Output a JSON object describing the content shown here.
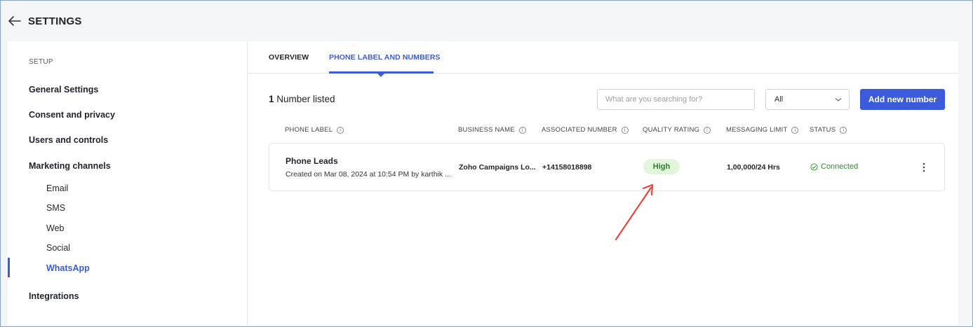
{
  "header": {
    "title": "SETTINGS"
  },
  "sidebar": {
    "section_label": "SETUP",
    "items": [
      {
        "label": "General Settings"
      },
      {
        "label": "Consent and privacy"
      },
      {
        "label": "Users and controls"
      },
      {
        "label": "Marketing channels"
      }
    ],
    "sub_items": [
      {
        "label": "Email"
      },
      {
        "label": "SMS"
      },
      {
        "label": "Web"
      },
      {
        "label": "Social"
      },
      {
        "label": "WhatsApp"
      }
    ],
    "integrations_label": "Integrations",
    "active_item": "WhatsApp"
  },
  "tabs": [
    {
      "label": "OVERVIEW"
    },
    {
      "label": "PHONE LABEL AND NUMBERS"
    }
  ],
  "active_tab": "PHONE LABEL AND NUMBERS",
  "toolbar": {
    "count": "1",
    "count_suffix": " Number listed",
    "search_placeholder": "What are you searching for?",
    "filter_value": "All",
    "add_button": "Add new number"
  },
  "table": {
    "columns": [
      "PHONE LABEL",
      "BUSINESS NAME",
      "ASSOCIATED NUMBER",
      "QUALITY RATING",
      "MESSAGING LIMIT",
      "STATUS"
    ],
    "rows": [
      {
        "label": "Phone Leads",
        "created": "Created on Mar 08, 2024 at 10:54 PM by karthik ...",
        "business_name": "Zoho Campaigns Lo...",
        "number": "+14158018898",
        "quality": "High",
        "limit": "1,00,000/24 Hrs",
        "status": "Connected"
      }
    ]
  },
  "colors": {
    "accent": "#3b5bdb",
    "badge_bg": "#e1f6db",
    "status_green": "#2e8b2e",
    "annotation_arrow": "#e8453c"
  },
  "icons": {
    "back": "arrow-left-icon",
    "info": "info-icon",
    "chevron": "chevron-down-icon",
    "status": "check-circle-icon",
    "menu": "more-vertical-icon"
  }
}
